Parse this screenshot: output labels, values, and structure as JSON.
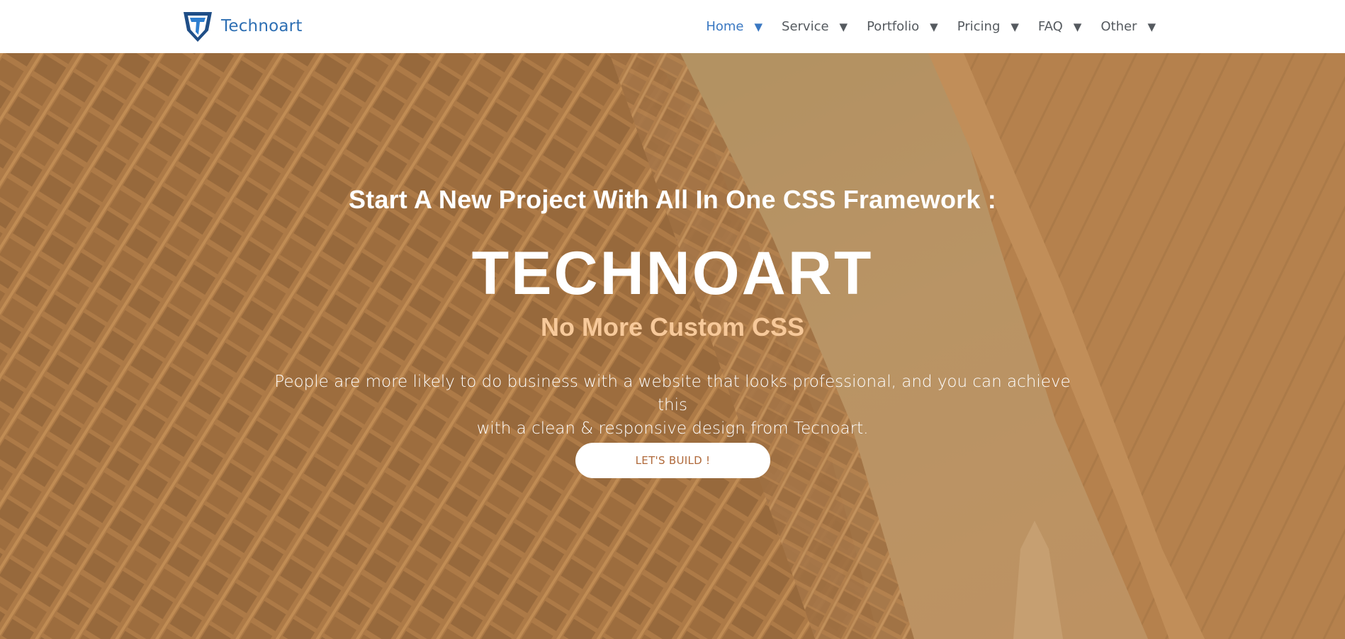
{
  "navbar": {
    "brand_name": "Technoart",
    "logo_icon": "technoart-shield-logo",
    "items": [
      {
        "label": "Home",
        "active": true,
        "caret": "▼"
      },
      {
        "label": "Service",
        "active": false,
        "caret": "▼"
      },
      {
        "label": "Portfolio",
        "active": false,
        "caret": "▼"
      },
      {
        "label": "Pricing",
        "active": false,
        "caret": "▼"
      },
      {
        "label": "FAQ",
        "active": false,
        "caret": "▼"
      },
      {
        "label": "Other",
        "active": false,
        "caret": "▼"
      }
    ]
  },
  "hero": {
    "pretitle": "Start A New Project With All In One CSS Framework :",
    "title": "TECHNOART",
    "tagline": "No More Custom CSS",
    "description_line1": "People are more likely to do business with a website that looks professional, and you can achieve this",
    "description_line2": "with a clean & responsive design from Tecnoart.",
    "cta_label": "LET'S BUILD !"
  },
  "colors": {
    "brand": "#2e6fb3",
    "nav_active": "#3a78c2",
    "nav_text": "#555a5f",
    "hero_overlay": "#b9864e",
    "tagline": "#f7c99a",
    "cta_text": "#b0693a"
  }
}
